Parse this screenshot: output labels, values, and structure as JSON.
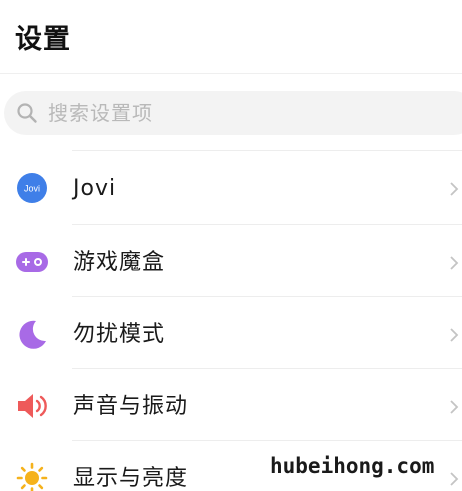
{
  "header": {
    "title": "设置"
  },
  "search": {
    "placeholder": "搜索设置项"
  },
  "items": [
    {
      "label": "Jovi",
      "icon": "jovi-icon",
      "icon_text": "Jovi",
      "color": "#3f7fe8"
    },
    {
      "label": "游戏魔盒",
      "icon": "game-controller-icon",
      "color": "#a86ae6"
    },
    {
      "label": "勿扰模式",
      "icon": "moon-icon",
      "color": "#a86ae6"
    },
    {
      "label": "声音与振动",
      "icon": "speaker-icon",
      "color": "#ee5a5a"
    },
    {
      "label": "显示与亮度",
      "icon": "sun-icon",
      "color": "#f5b21c"
    }
  ],
  "watermark": {
    "text": "hubeihong.com"
  }
}
